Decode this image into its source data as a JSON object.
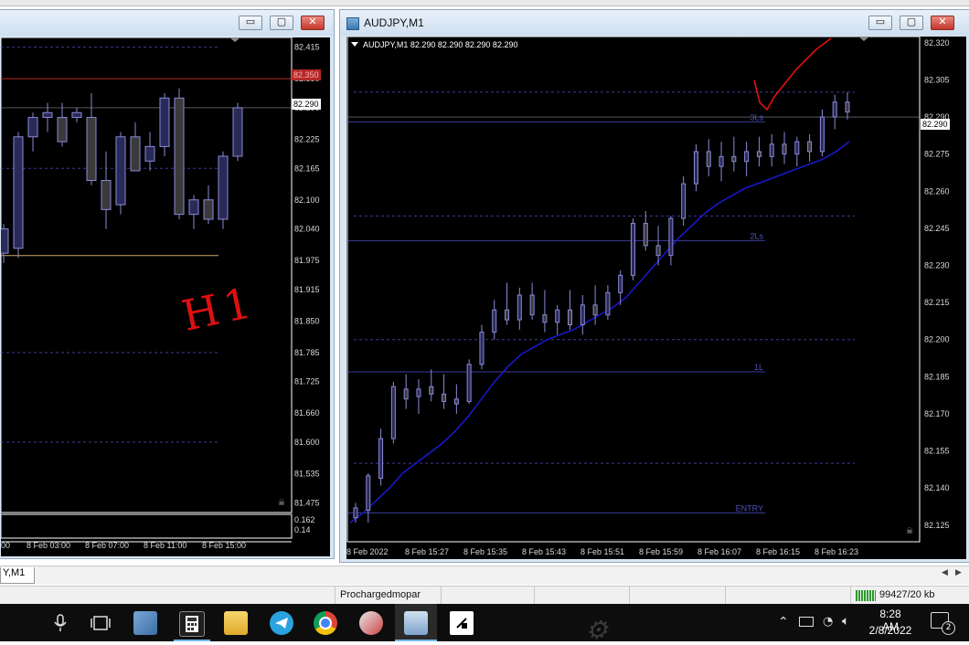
{
  "left_window": {
    "title": "",
    "buttons": {
      "minimize": "▭",
      "maximize": "▢",
      "close": "✕"
    },
    "price_axis": [
      "82.415",
      "82.350",
      "82.290",
      "82.225",
      "82.165",
      "82.100",
      "82.040",
      "81.975",
      "81.915",
      "81.850",
      "81.785",
      "81.725",
      "81.660",
      "81.600",
      "81.535",
      "81.475"
    ],
    "current_price": "82.290",
    "alert_price": "82.350",
    "indicator_axis": [
      "0.162",
      "0.14"
    ],
    "time_axis": [
      "00",
      "8 Feb 03:00",
      "8 Feb 07:00",
      "8 Feb 11:00",
      "8 Feb 15:00"
    ],
    "annotation_text": "H1",
    "candles": [
      {
        "o": 81.99,
        "h": 82.05,
        "l": 81.97,
        "c": 82.04
      },
      {
        "o": 82.0,
        "h": 82.24,
        "l": 81.98,
        "c": 82.23
      },
      {
        "o": 82.23,
        "h": 82.28,
        "l": 82.2,
        "c": 82.27
      },
      {
        "o": 82.27,
        "h": 82.3,
        "l": 82.24,
        "c": 82.28
      },
      {
        "o": 82.27,
        "h": 82.3,
        "l": 82.21,
        "c": 82.22
      },
      {
        "o": 82.27,
        "h": 82.29,
        "l": 82.26,
        "c": 82.28
      },
      {
        "o": 82.27,
        "h": 82.32,
        "l": 82.13,
        "c": 82.14
      },
      {
        "o": 82.14,
        "h": 82.2,
        "l": 82.04,
        "c": 82.08
      },
      {
        "o": 82.09,
        "h": 82.24,
        "l": 82.07,
        "c": 82.23
      },
      {
        "o": 82.23,
        "h": 82.26,
        "l": 82.17,
        "c": 82.16
      },
      {
        "o": 82.18,
        "h": 82.24,
        "l": 82.16,
        "c": 82.21
      },
      {
        "o": 82.21,
        "h": 82.32,
        "l": 82.19,
        "c": 82.31
      },
      {
        "o": 82.31,
        "h": 82.33,
        "l": 82.06,
        "c": 82.07
      },
      {
        "o": 82.07,
        "h": 82.11,
        "l": 82.04,
        "c": 82.1
      },
      {
        "o": 82.1,
        "h": 82.13,
        "l": 82.05,
        "c": 82.06
      },
      {
        "o": 82.06,
        "h": 82.2,
        "l": 82.04,
        "c": 82.19
      },
      {
        "o": 82.19,
        "h": 82.3,
        "l": 82.18,
        "c": 82.29
      }
    ]
  },
  "right_window": {
    "title": "AUDJPY,M1",
    "chart_header": "AUDJPY,M1  82.290 82.290 82.290 82.290",
    "buttons": {
      "minimize": "▭",
      "maximize": "▢",
      "close": "✕"
    },
    "price_axis": [
      "82.320",
      "82.305",
      "82.290",
      "82.275",
      "82.260",
      "82.245",
      "82.230",
      "82.215",
      "82.200",
      "82.185",
      "82.170",
      "82.155",
      "82.140",
      "82.125"
    ],
    "current_price": "82.290",
    "time_axis": [
      "8 Feb 2022",
      "8 Feb 15:27",
      "8 Feb 15:35",
      "8 Feb 15:43",
      "8 Feb 15:51",
      "8 Feb 15:59",
      "8 Feb 16:07",
      "8 Feb 16:15",
      "8 Feb 16:23"
    ],
    "level_labels": {
      "l3": "3Ls",
      "l2": "2Ls",
      "l1": "1L",
      "entry": "ENTRY"
    },
    "levels": {
      "l3": 82.288,
      "l2": 82.24,
      "l1": 82.187,
      "entry": 82.13
    },
    "dotted_levels": [
      82.3,
      82.25,
      82.2,
      82.15
    ],
    "ma": [
      82.126,
      82.13,
      82.135,
      82.14,
      82.146,
      82.15,
      82.154,
      82.158,
      82.163,
      82.169,
      82.176,
      82.183,
      82.189,
      82.194,
      82.197,
      82.2,
      82.202,
      82.204,
      82.207,
      82.21,
      82.213,
      82.217,
      82.223,
      82.229,
      82.235,
      82.241,
      82.246,
      82.251,
      82.255,
      82.258,
      82.261,
      82.263,
      82.265,
      82.267,
      82.269,
      82.271,
      82.273,
      82.276,
      82.28
    ],
    "candles": [
      {
        "o": 82.128,
        "h": 82.134,
        "l": 82.126,
        "c": 82.132
      },
      {
        "o": 82.131,
        "h": 82.146,
        "l": 82.126,
        "c": 82.145
      },
      {
        "o": 82.144,
        "h": 82.164,
        "l": 82.141,
        "c": 82.16
      },
      {
        "o": 82.16,
        "h": 82.183,
        "l": 82.158,
        "c": 82.181
      },
      {
        "o": 82.18,
        "h": 82.186,
        "l": 82.172,
        "c": 82.176
      },
      {
        "o": 82.177,
        "h": 82.184,
        "l": 82.17,
        "c": 82.18
      },
      {
        "o": 82.181,
        "h": 82.188,
        "l": 82.175,
        "c": 82.178
      },
      {
        "o": 82.178,
        "h": 82.186,
        "l": 82.172,
        "c": 82.175
      },
      {
        "o": 82.176,
        "h": 82.182,
        "l": 82.17,
        "c": 82.174
      },
      {
        "o": 82.175,
        "h": 82.192,
        "l": 82.174,
        "c": 82.19
      },
      {
        "o": 82.19,
        "h": 82.206,
        "l": 82.188,
        "c": 82.203
      },
      {
        "o": 82.203,
        "h": 82.216,
        "l": 82.2,
        "c": 82.212
      },
      {
        "o": 82.212,
        "h": 82.223,
        "l": 82.206,
        "c": 82.208
      },
      {
        "o": 82.208,
        "h": 82.221,
        "l": 82.204,
        "c": 82.218
      },
      {
        "o": 82.218,
        "h": 82.223,
        "l": 82.208,
        "c": 82.21
      },
      {
        "o": 82.21,
        "h": 82.22,
        "l": 82.203,
        "c": 82.207
      },
      {
        "o": 82.207,
        "h": 82.214,
        "l": 82.202,
        "c": 82.212
      },
      {
        "o": 82.212,
        "h": 82.22,
        "l": 82.204,
        "c": 82.206
      },
      {
        "o": 82.206,
        "h": 82.218,
        "l": 82.202,
        "c": 82.214
      },
      {
        "o": 82.214,
        "h": 82.222,
        "l": 82.206,
        "c": 82.21
      },
      {
        "o": 82.21,
        "h": 82.222,
        "l": 82.208,
        "c": 82.219
      },
      {
        "o": 82.219,
        "h": 82.228,
        "l": 82.214,
        "c": 82.226
      },
      {
        "o": 82.226,
        "h": 82.249,
        "l": 82.224,
        "c": 82.247
      },
      {
        "o": 82.247,
        "h": 82.252,
        "l": 82.236,
        "c": 82.238
      },
      {
        "o": 82.238,
        "h": 82.246,
        "l": 82.23,
        "c": 82.234
      },
      {
        "o": 82.234,
        "h": 82.25,
        "l": 82.23,
        "c": 82.249
      },
      {
        "o": 82.249,
        "h": 82.266,
        "l": 82.246,
        "c": 82.263
      },
      {
        "o": 82.263,
        "h": 82.279,
        "l": 82.26,
        "c": 82.276
      },
      {
        "o": 82.276,
        "h": 82.281,
        "l": 82.266,
        "c": 82.27
      },
      {
        "o": 82.27,
        "h": 82.28,
        "l": 82.264,
        "c": 82.274
      },
      {
        "o": 82.274,
        "h": 82.282,
        "l": 82.268,
        "c": 82.272
      },
      {
        "o": 82.272,
        "h": 82.28,
        "l": 82.266,
        "c": 82.276
      },
      {
        "o": 82.276,
        "h": 82.282,
        "l": 82.27,
        "c": 82.274
      },
      {
        "o": 82.274,
        "h": 82.283,
        "l": 82.27,
        "c": 82.279
      },
      {
        "o": 82.279,
        "h": 82.284,
        "l": 82.271,
        "c": 82.275
      },
      {
        "o": 82.275,
        "h": 82.282,
        "l": 82.27,
        "c": 82.28
      },
      {
        "o": 82.28,
        "h": 82.283,
        "l": 82.272,
        "c": 82.276
      },
      {
        "o": 82.276,
        "h": 82.293,
        "l": 82.274,
        "c": 82.29
      },
      {
        "o": 82.29,
        "h": 82.299,
        "l": 82.285,
        "c": 82.296
      },
      {
        "o": 82.296,
        "h": 82.3,
        "l": 82.289,
        "c": 82.292
      }
    ]
  },
  "tab_label": "Y,M1",
  "statusbar": {
    "profile": "Prochargedmopar",
    "traffic": "99427/20 kb"
  },
  "taskbar": {
    "time": "8:28 AM",
    "date": "2/8/2022",
    "notification_count": "2",
    "icons": [
      "microphone-icon",
      "task-view-icon",
      "control-panel-icon",
      "calculator-icon",
      "file-explorer-icon",
      "telegram-icon",
      "chrome-icon",
      "snipping-tool-icon",
      "metatrader-icon",
      "sticky-notes-icon"
    ]
  },
  "colors": {
    "bull": "#2a2a58",
    "bear": "#3a3a3a",
    "wick": "#8a8ad8",
    "level": "#3c3c9c",
    "ma": "#1818c8",
    "annotation": "#e01010"
  }
}
